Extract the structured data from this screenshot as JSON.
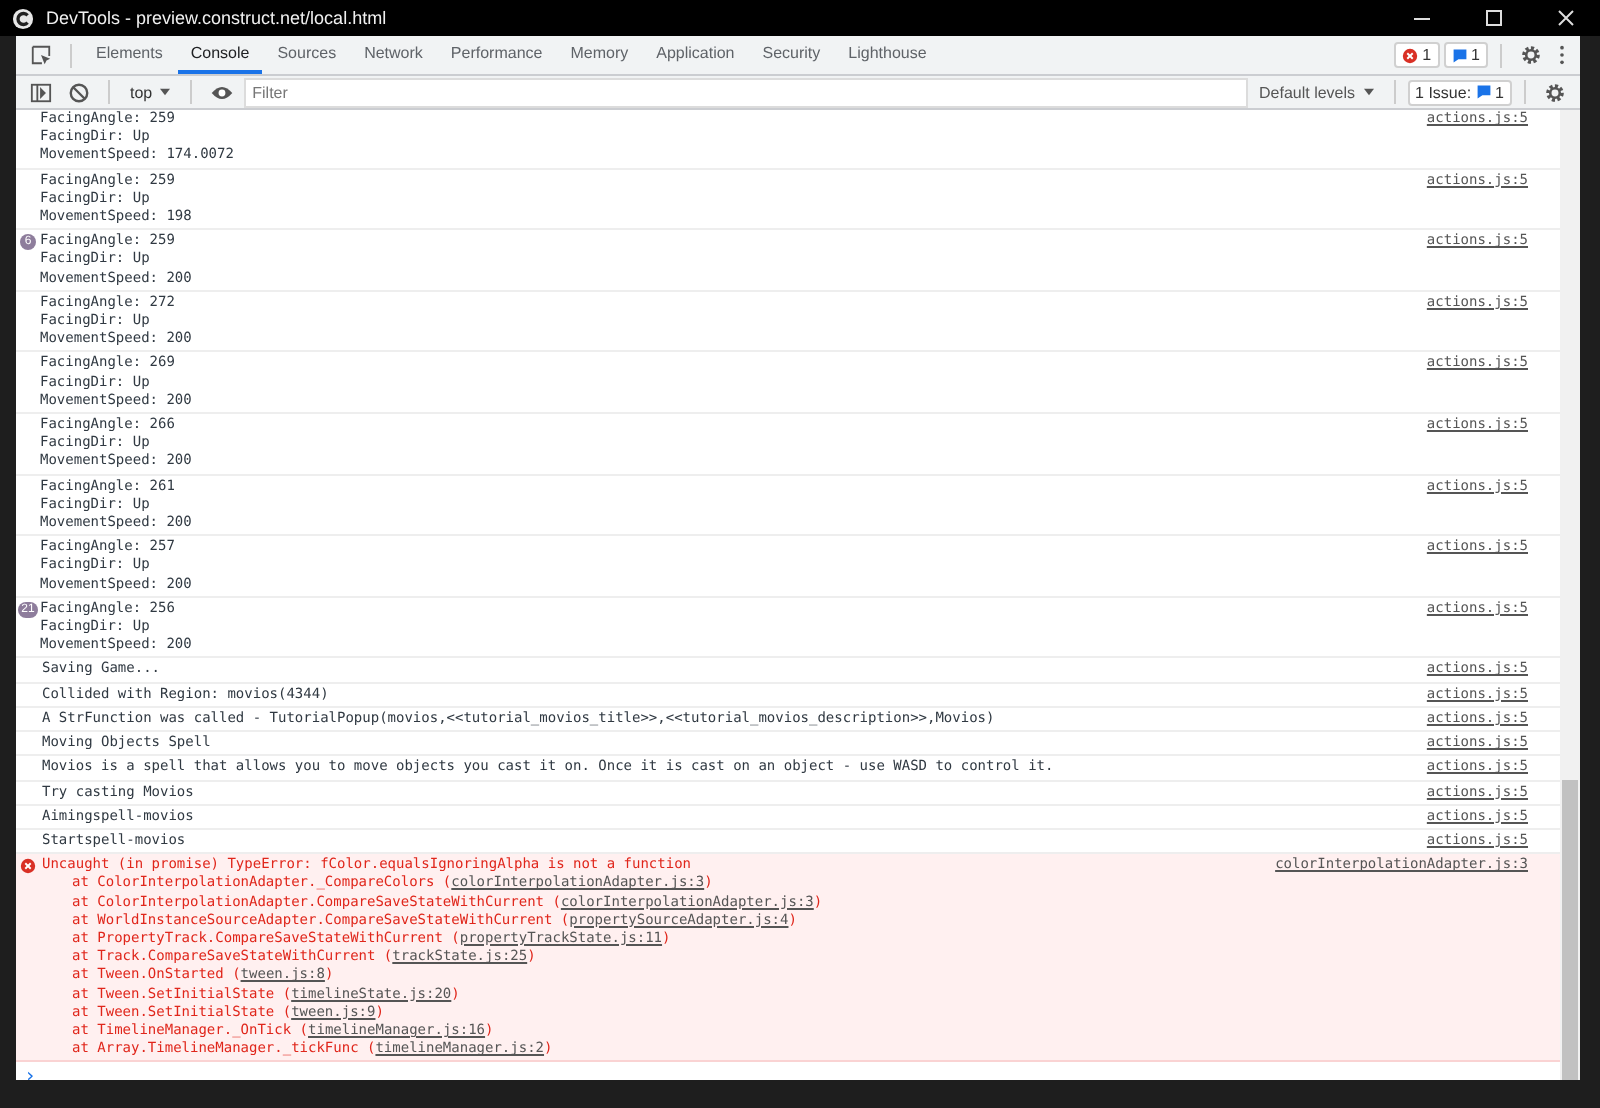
{
  "window": {
    "title": "DevTools - preview.construct.net/local.html"
  },
  "tabs": [
    {
      "label": "Elements",
      "selected": false
    },
    {
      "label": "Console",
      "selected": true
    },
    {
      "label": "Sources",
      "selected": false
    },
    {
      "label": "Network",
      "selected": false
    },
    {
      "label": "Performance",
      "selected": false
    },
    {
      "label": "Memory",
      "selected": false
    },
    {
      "label": "Application",
      "selected": false
    },
    {
      "label": "Security",
      "selected": false
    },
    {
      "label": "Lighthouse",
      "selected": false
    }
  ],
  "counters": {
    "errors": "1",
    "messages": "1"
  },
  "toolbar": {
    "context": "top",
    "filter": {
      "placeholder": "Filter"
    },
    "levels": "Default levels",
    "issues": {
      "label": "1 Issue:",
      "count": "1"
    }
  },
  "logs": [
    {
      "kind": "group",
      "lines": [
        "FacingAngle: 259",
        "FacingDir: Up",
        "MovementSpeed: 174.0072"
      ],
      "source": "actions.js:5"
    },
    {
      "kind": "group",
      "lines": [
        "FacingAngle: 259",
        "FacingDir: Up",
        "MovementSpeed: 198"
      ],
      "source": "actions.js:5"
    },
    {
      "kind": "group",
      "repeat": "6",
      "lines": [
        "FacingAngle: 259",
        "FacingDir: Up",
        "MovementSpeed: 200"
      ],
      "source": "actions.js:5"
    },
    {
      "kind": "group",
      "lines": [
        "FacingAngle: 272",
        "FacingDir: Up",
        "MovementSpeed: 200"
      ],
      "source": "actions.js:5"
    },
    {
      "kind": "group",
      "lines": [
        "FacingAngle: 269",
        "FacingDir: Up",
        "MovementSpeed: 200"
      ],
      "source": "actions.js:5"
    },
    {
      "kind": "group",
      "lines": [
        "FacingAngle: 266",
        "FacingDir: Up",
        "MovementSpeed: 200"
      ],
      "source": "actions.js:5"
    },
    {
      "kind": "group",
      "lines": [
        "FacingAngle: 261",
        "FacingDir: Up",
        "MovementSpeed: 200"
      ],
      "source": "actions.js:5"
    },
    {
      "kind": "group",
      "lines": [
        "FacingAngle: 257",
        "FacingDir: Up",
        "MovementSpeed: 200"
      ],
      "source": "actions.js:5"
    },
    {
      "kind": "group",
      "repeat": "21",
      "lines": [
        "FacingAngle: 256",
        "FacingDir: Up",
        "MovementSpeed: 200"
      ],
      "source": "actions.js:5"
    },
    {
      "kind": "line",
      "lines": [
        "Saving Game..."
      ],
      "source": "actions.js:5"
    },
    {
      "kind": "line",
      "lines": [
        "Collided with Region: movios(4344)"
      ],
      "source": "actions.js:5"
    },
    {
      "kind": "line",
      "lines": [
        "A StrFunction was called - TutorialPopup(movios,<<tutorial_movios_title>>,<<tutorial_movios_description>>,Movios)"
      ],
      "source": "actions.js:5"
    },
    {
      "kind": "line",
      "lines": [
        "Moving Objects Spell"
      ],
      "source": "actions.js:5"
    },
    {
      "kind": "line",
      "lines": [
        "Movios is a spell that allows you to move objects you cast it on. Once it is cast on an object - use WASD to control it."
      ],
      "source": "actions.js:5"
    },
    {
      "kind": "line",
      "lines": [
        "Try casting Movios"
      ],
      "source": "actions.js:5"
    },
    {
      "kind": "line",
      "lines": [
        "Aimingspell-movios"
      ],
      "source": "actions.js:5"
    },
    {
      "kind": "line",
      "lines": [
        "Startspell-movios"
      ],
      "source": "actions.js:5"
    }
  ],
  "error": {
    "message": "Uncaught (in promise) TypeError: fColor.equalsIgnoringAlpha is not a function",
    "source": "colorInterpolationAdapter.js:3",
    "stack": [
      {
        "text": "at ColorInterpolationAdapter._CompareColors (",
        "link": "colorInterpolationAdapter.js:3",
        "end": ")"
      },
      {
        "text": "at ColorInterpolationAdapter.CompareSaveStateWithCurrent (",
        "link": "colorInterpolationAdapter.js:3",
        "end": ")"
      },
      {
        "text": "at WorldInstanceSourceAdapter.CompareSaveStateWithCurrent (",
        "link": "propertySourceAdapter.js:4",
        "end": ")"
      },
      {
        "text": "at PropertyTrack.CompareSaveStateWithCurrent (",
        "link": "propertyTrackState.js:11",
        "end": ")"
      },
      {
        "text": "at Track.CompareSaveStateWithCurrent (",
        "link": "trackState.js:25",
        "end": ")"
      },
      {
        "text": "at Tween.OnStarted (",
        "link": "tween.js:8",
        "end": ")"
      },
      {
        "text": "at Tween.SetInitialState (",
        "link": "timelineState.js:20",
        "end": ")"
      },
      {
        "text": "at Tween.SetInitialState (",
        "link": "tween.js:9",
        "end": ")"
      },
      {
        "text": "at TimelineManager._OnTick (",
        "link": "timelineManager.js:16",
        "end": ")"
      },
      {
        "text": "at Array.TimelineManager._tickFunc (",
        "link": "timelineManager.js:2",
        "end": ")"
      }
    ]
  },
  "prompt": {
    "symbol": "›"
  }
}
